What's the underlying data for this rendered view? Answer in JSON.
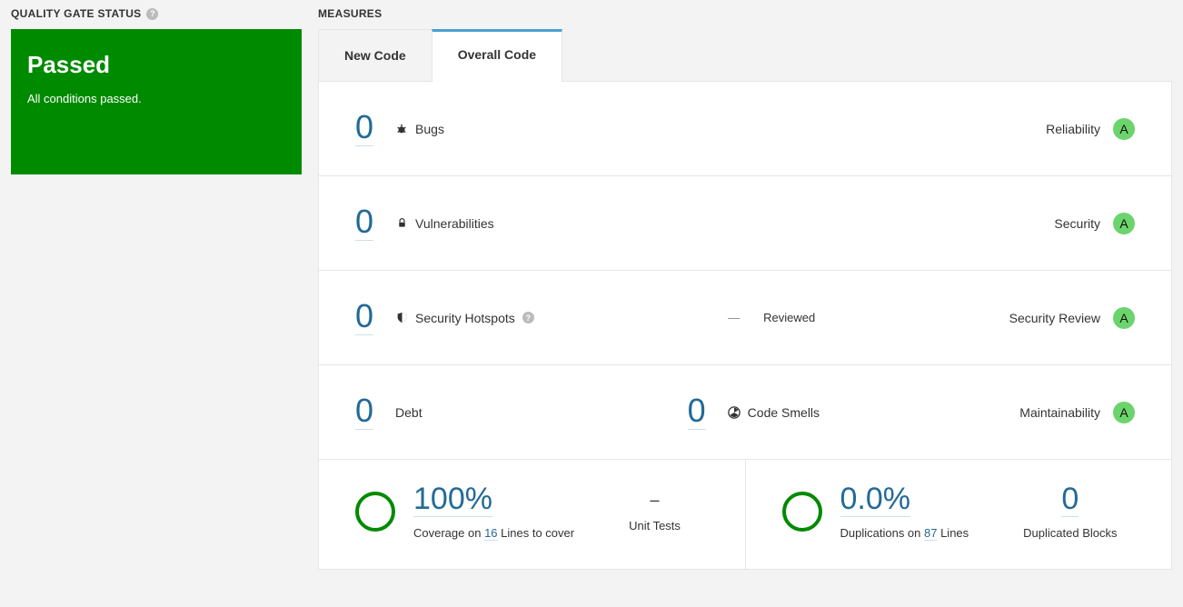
{
  "left": {
    "heading": "Quality Gate Status",
    "status_title": "Passed",
    "status_sub": "All conditions passed."
  },
  "right": {
    "heading": "Measures",
    "tabs": {
      "new_code": "New Code",
      "overall_code": "Overall Code",
      "active": "overall"
    },
    "rows": {
      "bugs": {
        "count": "0",
        "label": "Bugs",
        "rating_label": "Reliability",
        "rating": "A"
      },
      "vulns": {
        "count": "0",
        "label": "Vulnerabilities",
        "rating_label": "Security",
        "rating": "A"
      },
      "hotspots": {
        "count": "0",
        "label": "Security Hotspots",
        "reviewed_label": "Reviewed",
        "rating_label": "Security Review",
        "rating": "A"
      },
      "debt": {
        "count": "0",
        "label": "Debt"
      },
      "smells": {
        "count": "0",
        "label": "Code Smells",
        "rating_label": "Maintainability",
        "rating": "A"
      }
    },
    "coverage": {
      "value": "100%",
      "text_prefix": "Coverage on ",
      "lines": "16",
      "text_suffix": " Lines to cover",
      "unit_tests_value": "–",
      "unit_tests_label": "Unit Tests"
    },
    "duplications": {
      "value": "0.0%",
      "text_prefix": "Duplications on ",
      "lines": "87",
      "text_suffix": " Lines",
      "blocks_value": "0",
      "blocks_label": "Duplicated Blocks"
    }
  }
}
